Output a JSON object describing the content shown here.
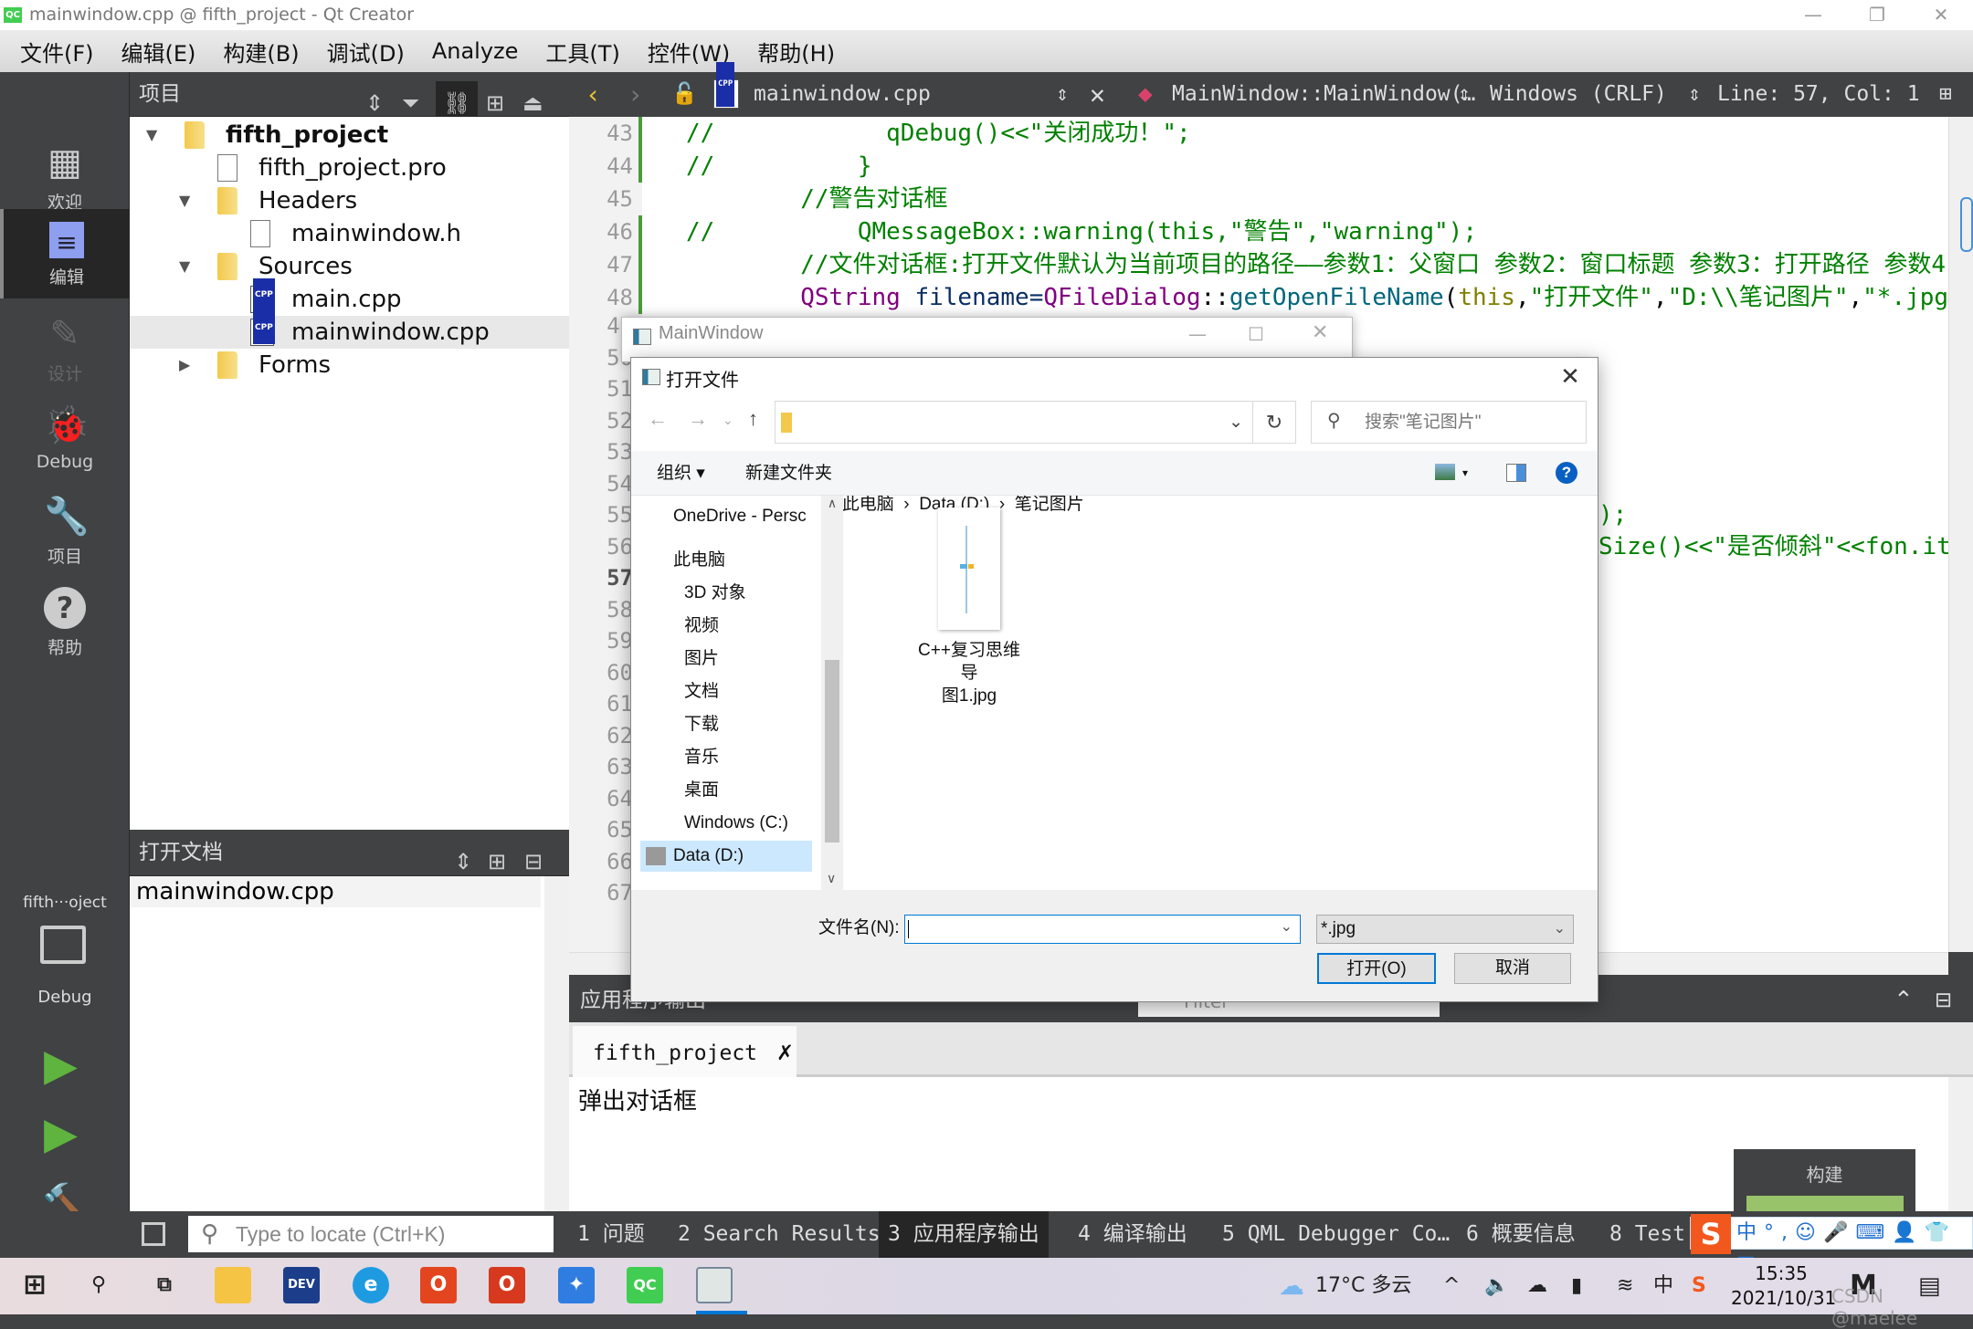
{
  "window": {
    "title": "mainwindow.cpp @ fifth_project - Qt Creator"
  },
  "menu": [
    "文件(F)",
    "编辑(E)",
    "构建(B)",
    "调试(D)",
    "Analyze",
    "工具(T)",
    "控件(W)",
    "帮助(H)"
  ],
  "modes": [
    {
      "label": "欢迎",
      "icon": "grid-icon"
    },
    {
      "label": "编辑",
      "icon": "edit-document-icon",
      "active": true
    },
    {
      "label": "设计",
      "icon": "pencil-icon",
      "disabled": true
    },
    {
      "label": "Debug",
      "icon": "bug-icon"
    },
    {
      "label": "项目",
      "icon": "wrench-icon"
    },
    {
      "label": "帮助",
      "icon": "help-icon"
    }
  ],
  "kit": {
    "project": "fifth···oject",
    "config": "Debug"
  },
  "project_pane": {
    "title": "项目",
    "tree": [
      {
        "label": "fifth_project",
        "level": 0,
        "expanded": true,
        "icon": "qt-project-folder-icon",
        "bold": true
      },
      {
        "label": "fifth_project.pro",
        "level": 1,
        "icon": "pro-file-icon"
      },
      {
        "label": "Headers",
        "level": 1,
        "expanded": true,
        "icon": "headers-folder-icon"
      },
      {
        "label": "mainwindow.h",
        "level": 2,
        "icon": "header-file-icon"
      },
      {
        "label": "Sources",
        "level": 1,
        "expanded": true,
        "icon": "sources-folder-icon"
      },
      {
        "label": "main.cpp",
        "level": 2,
        "icon": "cpp-file-icon"
      },
      {
        "label": "mainwindow.cpp",
        "level": 2,
        "icon": "cpp-file-icon",
        "selected": true
      },
      {
        "label": "Forms",
        "level": 1,
        "expanded": false,
        "icon": "forms-folder-icon"
      }
    ]
  },
  "open_docs": {
    "title": "打开文档",
    "items": [
      "mainwindow.cpp"
    ]
  },
  "editor": {
    "file": "mainwindow.cpp",
    "symbol": "MainWindow::MainWindow(…",
    "line_ending": "Windows (CRLF)",
    "position": "Line: 57, Col: 1",
    "current_line": 57,
    "lines": [
      {
        "n": 43,
        "seg": [
          {
            "t": "//            qDebug()<<\"关闭成功！\";",
            "c": "com"
          }
        ]
      },
      {
        "n": 44,
        "seg": [
          {
            "t": "//          }",
            "c": "com"
          }
        ]
      },
      {
        "n": 45,
        "seg": [
          {
            "t": "        //警告对话框",
            "c": "com"
          }
        ]
      },
      {
        "n": 46,
        "seg": [
          {
            "t": "//          QMessageBox::warning(this,\"警告\",\"warning\");",
            "c": "com"
          }
        ]
      },
      {
        "n": 47,
        "seg": [
          {
            "t": "        //文件对话框:打开文件默认为当前项目的路径——参数1：父窗口 参数2：窗口标题 参数3：打开路径 参数4:",
            "c": "com"
          }
        ]
      },
      {
        "n": 48,
        "seg": [
          {
            "t": "        ",
            "c": ""
          },
          {
            "t": "QString",
            "c": "type"
          },
          {
            "t": " filename=",
            "c": "var"
          },
          {
            "t": "QFileDialog",
            "c": "type"
          },
          {
            "t": "::",
            "c": ""
          },
          {
            "t": "getOpenFileName",
            "c": "fn"
          },
          {
            "t": "(",
            "c": ""
          },
          {
            "t": "this",
            "c": "kw"
          },
          {
            "t": ",",
            "c": ""
          },
          {
            "t": "\"打开文件\"",
            "c": "str"
          },
          {
            "t": ",",
            "c": ""
          },
          {
            "t": "\"D:\\\\笔记图片\"",
            "c": "str"
          },
          {
            "t": ",",
            "c": ""
          },
          {
            "t": "\"*.jpg\"",
            "c": "str"
          }
        ]
      }
    ],
    "hidden_line_numbers": [
      49,
      50,
      51,
      52,
      53,
      54,
      55,
      56,
      57,
      58,
      59,
      60,
      61,
      62,
      63,
      64,
      65,
      66,
      67
    ],
    "fragments": [
      {
        "line": 55,
        "text": ");"
      },
      {
        "line": 56,
        "text": "Size()<<\"是否倾斜\"<<fon.it"
      }
    ]
  },
  "mainwindow": {
    "title": "MainWindow"
  },
  "dialog": {
    "title": "打开文件",
    "breadcrumb": [
      "此电脑",
      "Data (D:)",
      "笔记图片"
    ],
    "search_placeholder": "搜索\"笔记图片\"",
    "organize": "组织 ▾",
    "new_folder": "新建文件夹",
    "nav": [
      {
        "label": "OneDrive - Persc",
        "icon": "onedrive-icon"
      },
      {
        "label": "此电脑",
        "icon": "this-pc-icon"
      },
      {
        "label": "3D 对象",
        "icon": "3d-objects-icon"
      },
      {
        "label": "视频",
        "icon": "videos-icon"
      },
      {
        "label": "图片",
        "icon": "pictures-icon"
      },
      {
        "label": "文档",
        "icon": "documents-icon"
      },
      {
        "label": "下载",
        "icon": "downloads-icon"
      },
      {
        "label": "音乐",
        "icon": "music-icon"
      },
      {
        "label": "桌面",
        "icon": "desktop-icon"
      },
      {
        "label": "Windows (C:)",
        "icon": "drive-c-icon"
      },
      {
        "label": "Data (D:)",
        "icon": "drive-d-icon",
        "selected": true
      }
    ],
    "files": [
      {
        "name": "C++复习思维导图1.jpg",
        "line1": "C++复习思维导",
        "line2": "图1.jpg"
      }
    ],
    "filename_label": "文件名(N):",
    "filename_value": "",
    "filter": "*.jpg",
    "open_label": "打开(O)",
    "cancel_label": "取消"
  },
  "output": {
    "title": "应用程序输出",
    "filter_placeholder": "Filter",
    "tab": "fifth_project",
    "text": "弹出对话框"
  },
  "build_popup": {
    "label": "构建",
    "progress": 1.0,
    "color": "#99c36a"
  },
  "bottom_bar": {
    "locate_placeholder": "Type to locate (Ctrl+K)",
    "tabs": [
      "1 问题",
      "2 Search Results",
      "3 应用程序输出",
      "4 编译输出",
      "5 QML Debugger Co…",
      "6 概要信息",
      "8 Test"
    ],
    "active_tab": 2
  },
  "ime": {
    "mode": "中"
  },
  "taskbar": {
    "weather": "17°C 多云",
    "input_lang": "中",
    "time": "15:35",
    "date": "2021/10/31",
    "watermark": "CSDN @maelee",
    "apps": [
      "start-icon",
      "search-icon",
      "task-view-icon",
      "file-explorer-icon",
      "devcpp-icon",
      "edge-icon",
      "office-icon",
      "office-icon-2",
      "feishu-icon",
      "qt-creator-icon",
      "running-app-icon"
    ]
  }
}
